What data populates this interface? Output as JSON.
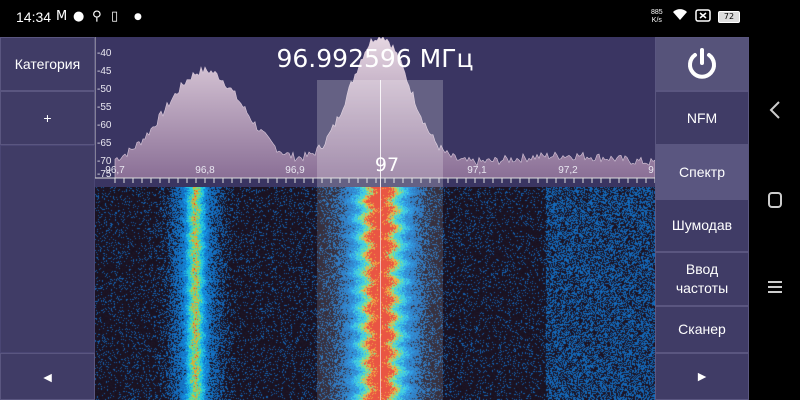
{
  "status_bar": {
    "time": "14:34",
    "net_speed_value": "885",
    "net_speed_unit": "K/s",
    "battery": "72"
  },
  "left_panel": {
    "category_label": "Категория",
    "add_label": "+",
    "prev_label": "◄"
  },
  "right_panel": {
    "mode_label": "NFM",
    "spectrum_label": "Спектр",
    "squelch_label": "Шумодав",
    "freq_input_label": "Ввод частоты",
    "scanner_label": "Сканер",
    "next_label": "►"
  },
  "spectrum": {
    "frequency_readout": "96.992596 МГц",
    "center_label": "97",
    "y_ticks": [
      "-40",
      "-45",
      "-50",
      "-55",
      "-60",
      "-65",
      "-70",
      "-75"
    ],
    "x_ticks": [
      "96,7",
      "96,8",
      "96,9",
      "97,1",
      "97,2",
      "9"
    ]
  },
  "colors": {
    "panel_bg": "#44406a",
    "button_border": "#5a5680",
    "spectrum_bg": "#3a3562",
    "spectrum_fill": "#c9b3c8"
  }
}
